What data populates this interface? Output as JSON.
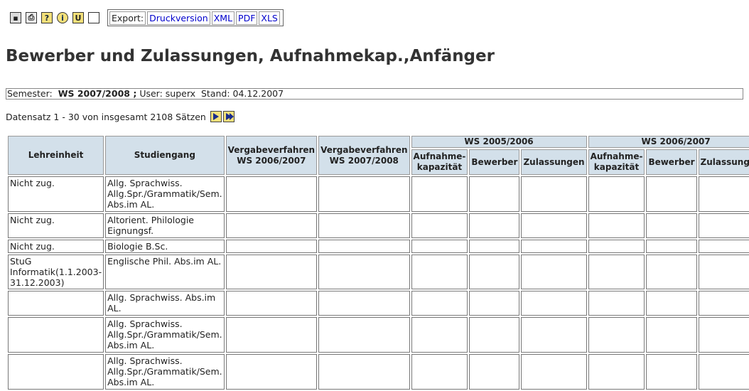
{
  "toolbar": {
    "icons": [
      {
        "name": "save-icon",
        "glyph": "▣"
      },
      {
        "name": "print-icon",
        "glyph": "⎙"
      },
      {
        "name": "help-icon",
        "glyph": "?"
      },
      {
        "name": "info-icon",
        "glyph": "i"
      },
      {
        "name": "clip-icon",
        "glyph": "U"
      },
      {
        "name": "table-icon",
        "glyph": ""
      }
    ],
    "export_label": "Export:",
    "export_links": [
      "Druckversion",
      "XML",
      "PDF",
      "XLS"
    ]
  },
  "title": "Bewerber und Zulassungen, Aufnahmekap.,Anfänger",
  "filter": {
    "semester_label": "Semester:",
    "semester_value": "WS 2007/2008 ;",
    "user": "User: superx",
    "stand": "Stand: 04.12.2007"
  },
  "pagination": {
    "text": "Datensatz 1 - 30 von insgesamt 2108 Sätzen"
  },
  "table": {
    "header_lehreinheit": "Lehreinheit",
    "header_studiengang": "Studiengang",
    "header_vergabe1": "Vergabeverfahren WS 2006/2007",
    "header_vergabe2": "Vergabeverfahren WS 2007/2008",
    "semester_groups": [
      "WS 2005/2006",
      "WS 2006/2007"
    ],
    "sub_headers": [
      "Aufnahme-kapazität",
      "Bewerber",
      "Zulassungen"
    ],
    "rows": [
      {
        "lehreinheit": "Nicht zug.",
        "studiengang": "Allg. Sprachwiss. Allg.Spr./Grammatik/Sem. Abs.im AL.",
        "h": 50
      },
      {
        "lehreinheit": "Nicht zug.",
        "studiengang": "Altorient. Philologie Eignungsf.",
        "h": 35
      },
      {
        "lehreinheit": "Nicht zug.",
        "studiengang": "Biologie B.Sc.",
        "h": 19
      },
      {
        "lehreinheit": "StuG Informatik(1.1.2003-31.12.2003)",
        "studiengang": "Englische Phil. Abs.im AL.",
        "h": 35
      },
      {
        "lehreinheit": "",
        "studiengang": "Allg. Sprachwiss. Abs.im AL.",
        "h": 35
      },
      {
        "lehreinheit": "",
        "studiengang": "Allg. Sprachwiss. Allg.Spr./Grammatik/Sem. Abs.im AL.",
        "h": 50
      },
      {
        "lehreinheit": "",
        "studiengang": "Allg. Sprachwiss. Allg.Spr./Grammatik/Sem. Abs.im AL.",
        "h": 50
      }
    ]
  }
}
